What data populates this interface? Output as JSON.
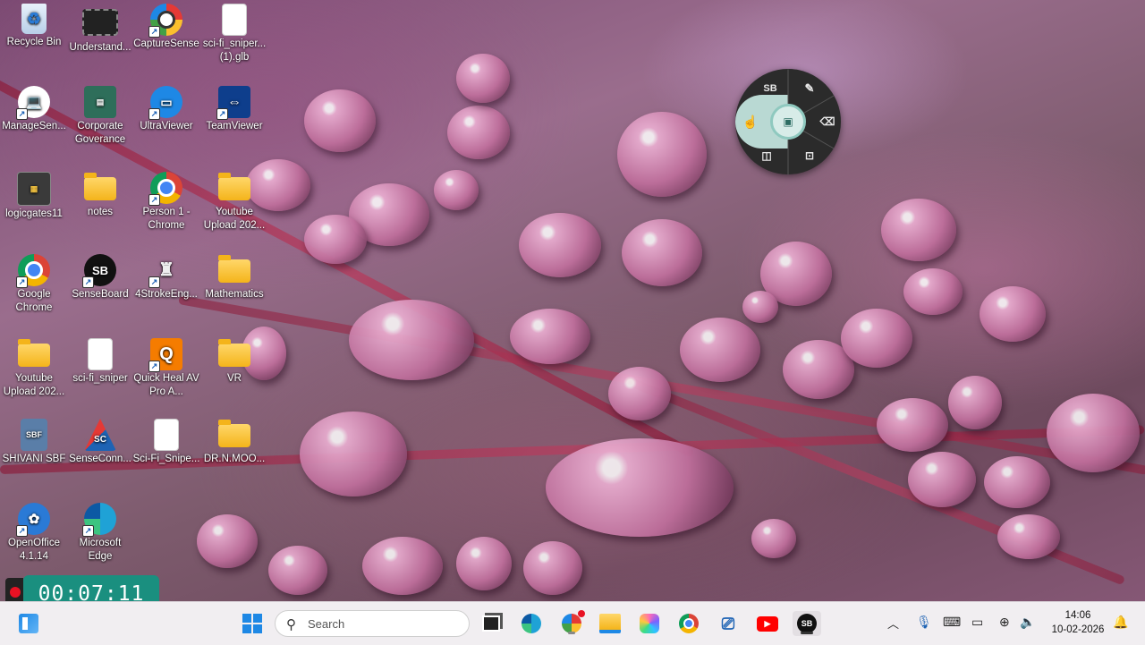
{
  "desktop": {
    "icons": [
      {
        "label": "Recycle Bin",
        "icon": "recycle-bin-icon"
      },
      {
        "label": "Understand...",
        "icon": "video-file-icon"
      },
      {
        "label": "CaptureSense",
        "icon": "capturesense-icon"
      },
      {
        "label": "sci-fi_sniper... (1).glb",
        "icon": "file-icon"
      },
      {
        "label": "ManageSen...",
        "icon": "manage-sense-icon"
      },
      {
        "label": "Corporate Goverance",
        "icon": "corporate-icon"
      },
      {
        "label": "UltraViewer",
        "icon": "ultraviewer-icon"
      },
      {
        "label": "TeamViewer",
        "icon": "teamviewer-icon"
      },
      {
        "label": "logicgates11",
        "icon": "logicgates-icon"
      },
      {
        "label": "notes",
        "icon": "folder-icon"
      },
      {
        "label": "Person 1 - Chrome",
        "icon": "chrome-profile-icon"
      },
      {
        "label": "Youtube Upload 202...",
        "icon": "folder-icon"
      },
      {
        "label": "Google Chrome",
        "icon": "chrome-icon"
      },
      {
        "label": "SenseBoard",
        "icon": "senseboard-icon"
      },
      {
        "label": "4StrokeEng...",
        "icon": "engine-icon"
      },
      {
        "label": "Mathematics",
        "icon": "folder-icon"
      },
      {
        "label": "Youtube Upload 202...",
        "icon": "folder-icon"
      },
      {
        "label": "sci-fi_sniper",
        "icon": "file-icon"
      },
      {
        "label": "Quick Heal AV Pro A...",
        "icon": "quickheal-icon"
      },
      {
        "label": "VR",
        "icon": "folder-icon"
      },
      {
        "label": "SHIVANI SBF",
        "icon": "sbf-file-icon"
      },
      {
        "label": "SenseConn...",
        "icon": "senseconnect-icon"
      },
      {
        "label": "Sci-Fi_Snipe...",
        "icon": "file-icon"
      },
      {
        "label": "DR.N.MOO...",
        "icon": "folder-icon"
      },
      {
        "label": "OpenOffice 4.1.14",
        "icon": "openoffice-icon"
      },
      {
        "label": "Microsoft Edge",
        "icon": "edge-icon"
      }
    ]
  },
  "radial_menu": {
    "sb_label": "SB",
    "items": [
      "pen-icon",
      "eraser-icon",
      "screenshot-icon",
      "split-view-icon",
      "pointer-icon",
      "screen-icon"
    ]
  },
  "recorder": {
    "time": "00:07:11"
  },
  "taskbar": {
    "search_placeholder": "Search",
    "sb_label": "SB",
    "time": "14:06",
    "date": "10-02-2026"
  }
}
